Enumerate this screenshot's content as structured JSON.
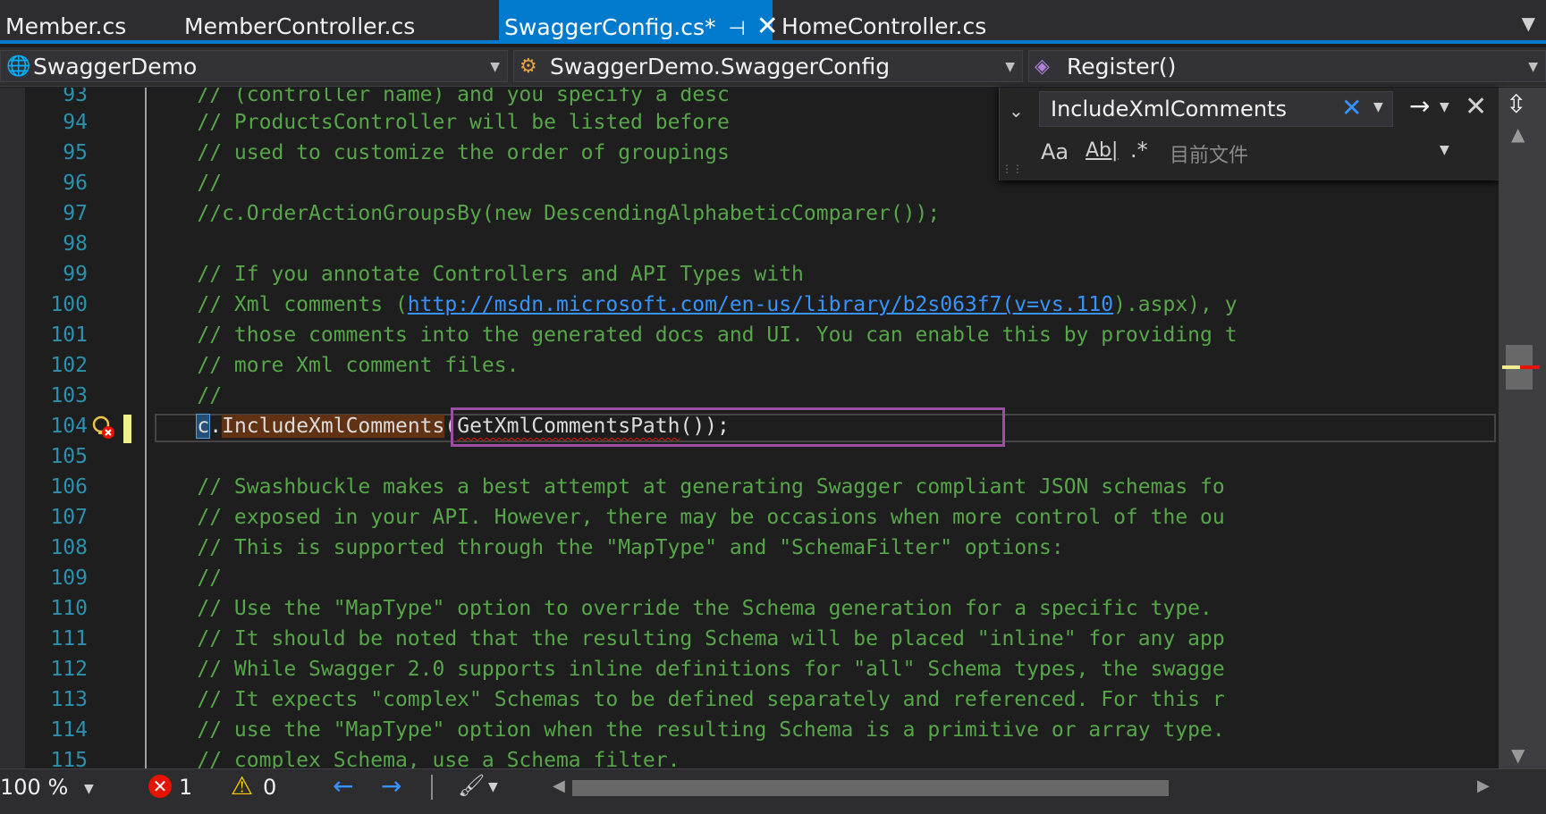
{
  "tabs": [
    {
      "label": "Member.cs",
      "active": false
    },
    {
      "label": "MemberController.cs",
      "active": false
    },
    {
      "label": "SwaggerConfig.cs*",
      "active": true,
      "pin": "⊣",
      "close": "✕"
    },
    {
      "label": "HomeController.cs",
      "active": false
    }
  ],
  "navbar": {
    "project": "SwaggerDemo",
    "project_icon": "globe-icon",
    "type": "SwaggerDemo.SwaggerConfig",
    "type_icon": "class-icon",
    "member": "Register()",
    "member_icon": "method-icon"
  },
  "find": {
    "query": "IncludeXmlComments",
    "scope_placeholder": "目前文件",
    "match_case_label": "Aa",
    "whole_word_label": "Ab|",
    "regex_label": ".*"
  },
  "editor": {
    "lines": [
      {
        "number": "93",
        "text": "    // (controller name) and you specify a desc"
      },
      {
        "number": "94",
        "text": "    // ProductsController will be listed before"
      },
      {
        "number": "95",
        "text": "    // used to customize the order of groupings"
      },
      {
        "number": "96",
        "text": "    //"
      },
      {
        "number": "97",
        "text": "    //c.OrderActionGroupsBy(new DescendingAlphabeticComparer());"
      },
      {
        "number": "98",
        "text": ""
      },
      {
        "number": "99",
        "text": "    // If you annotate Controllers and API Types with"
      },
      {
        "number": "100",
        "text_before": "    // Xml comments (",
        "link": "http://msdn.microsoft.com/en-us/library/b2s063f7(v=vs.110",
        "text_after": ").aspx), y"
      },
      {
        "number": "101",
        "text": "    // those comments into the generated docs and UI. You can enable this by providing t"
      },
      {
        "number": "102",
        "text": "    // more Xml comment files."
      },
      {
        "number": "103",
        "text": "    //"
      },
      {
        "number": "104",
        "code_c": "c",
        "code_dot": ".",
        "code_method": "IncludeXmlComments",
        "code_paren": "(",
        "code_arg": "GetXmlCommentsPath",
        "code_end": "());"
      },
      {
        "number": "105",
        "text": ""
      },
      {
        "number": "106",
        "text": "    // Swashbuckle makes a best attempt at generating Swagger compliant JSON schemas fo"
      },
      {
        "number": "107",
        "text": "    // exposed in your API. However, there may be occasions when more control of the ou"
      },
      {
        "number": "108",
        "text": "    // This is supported through the \"MapType\" and \"SchemaFilter\" options:"
      },
      {
        "number": "109",
        "text": "    //"
      },
      {
        "number": "110",
        "text": "    // Use the \"MapType\" option to override the Schema generation for a specific type."
      },
      {
        "number": "111",
        "text": "    // It should be noted that the resulting Schema will be placed \"inline\" for any app"
      },
      {
        "number": "112",
        "text": "    // While Swagger 2.0 supports inline definitions for \"all\" Schema types, the swagge"
      },
      {
        "number": "113",
        "text": "    // It expects \"complex\" Schemas to be defined separately and referenced. For this r"
      },
      {
        "number": "114",
        "text": "    // use the \"MapType\" option when the resulting Schema is a primitive or array type."
      },
      {
        "number": "115",
        "text": "    // complex Schema, use a Schema filter."
      }
    ]
  },
  "status": {
    "zoom": "100 %",
    "errors": "1",
    "warnings": "0",
    "horizontal_scroll_fraction": 0.66
  },
  "colors": {
    "accent": "#007acc",
    "comment": "#57a64a",
    "line_number": "#2b91af",
    "link": "#3794ff",
    "error": "#e51400",
    "find_highlight": "#613214",
    "match_outline": "#9b4fa3"
  }
}
